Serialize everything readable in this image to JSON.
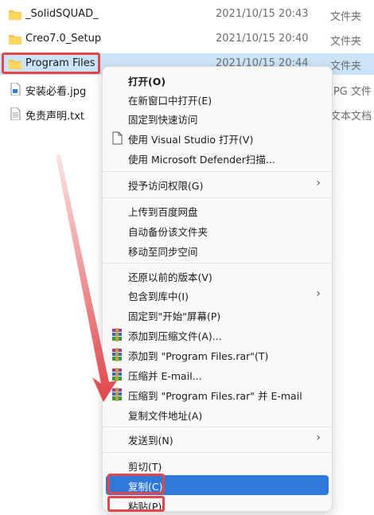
{
  "files": [
    {
      "name": "_SolidSQUAD_",
      "date": "2021/10/15 20:43",
      "type": "文件夹",
      "icon": "folder-icon"
    },
    {
      "name": "Creo7.0_Setup",
      "date": "2021/10/15 20:40",
      "type": "文件夹",
      "icon": "folder-icon"
    },
    {
      "name": "Program Files",
      "date": "2021/10/15 20:44",
      "type": "文件夹",
      "icon": "folder-icon"
    },
    {
      "name": "安装必看.jpg",
      "date": "",
      "type": "JPG 文件",
      "icon": "image-file-icon"
    },
    {
      "name": "免责声明.txt",
      "date": "",
      "type": "文本文档",
      "icon": "text-file-icon"
    }
  ],
  "menu": {
    "open": "打开(O)",
    "open_new_window": "在新窗口中打开(E)",
    "pin_quick_access": "固定到快速访问",
    "open_vs": "使用 Visual Studio 打开(V)",
    "defender": "使用 Microsoft Defender扫描...",
    "grant_access": "授予访问权限(G)",
    "upload_baidu": "上传到百度网盘",
    "auto_backup": "自动备份该文件夹",
    "move_sync": "移动至同步空间",
    "restore_prev": "还原以前的版本(V)",
    "include_library": "包含到库中(I)",
    "pin_start": "固定到\"开始\"屏幕(P)",
    "add_archive": "添加到压缩文件(A)...",
    "add_rar": "添加到 \"Program Files.rar\"(T)",
    "compress_email": "压缩并 E-mail...",
    "compress_rar_email": "压缩到 \"Program Files.rar\" 并 E-mail",
    "copy_path": "复制文件地址(A)",
    "send_to": "发送到(N)",
    "cut": "剪切(T)",
    "copy": "复制(C)",
    "paste": "粘贴(P)"
  },
  "colors": {
    "highlight": "#2f7ad8",
    "annotation": "#e0464b",
    "selected_row": "#cce4f7"
  }
}
